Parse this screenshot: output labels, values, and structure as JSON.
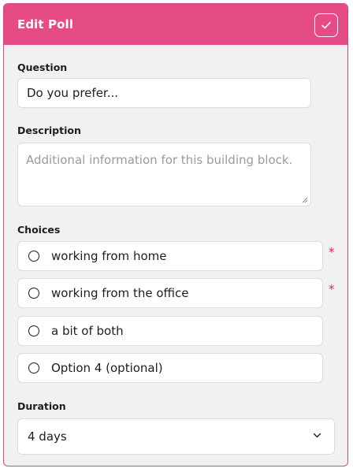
{
  "header": {
    "title": "Edit Poll",
    "confirm_icon": "check-icon"
  },
  "question": {
    "label": "Question",
    "value": "Do you prefer..."
  },
  "description": {
    "label": "Description",
    "placeholder": "Additional information for this building block."
  },
  "choices": {
    "label": "Choices",
    "items": [
      {
        "text": "working from home",
        "required": "*"
      },
      {
        "text": "working from the office",
        "required": "*"
      },
      {
        "text": "a bit of both"
      },
      {
        "placeholder": "Option 4 (optional)"
      }
    ]
  },
  "duration": {
    "label": "Duration",
    "selected": "4 days"
  },
  "colors": {
    "header": "#e54c85",
    "border": "#d1487b",
    "required": "#e0245e",
    "background": "#f2f1f1"
  }
}
